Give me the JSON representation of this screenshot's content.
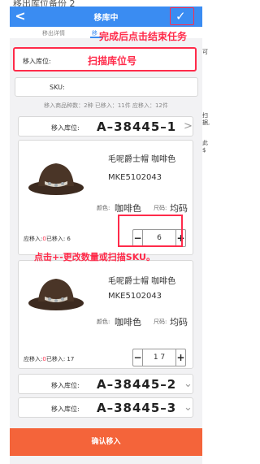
{
  "background": {
    "title": "移出库位备份 2",
    "right_top": "可",
    "right_mid": "扫据,",
    "right_low": "此$"
  },
  "navbar": {
    "back_icon": "chevron-left-icon",
    "title": "移库中",
    "confirm_icon": "check-icon",
    "color": "#3a8cf2"
  },
  "tabs": [
    {
      "label": "移出详情"
    },
    {
      "label": "移"
    }
  ],
  "callouts": {
    "finish": "完成后点击结束任务",
    "scan_location": "扫描库位号",
    "stepper_hint": "点击+-更改数量或扫描SKU。"
  },
  "location_field": {
    "label": "移入库位:"
  },
  "sku_field": {
    "label": "SKU:"
  },
  "stats": "移入商品种数：2种    已移入：11件    应移入：12件",
  "groups": [
    {
      "label": "移入库位:",
      "code": "A–38445–1",
      "items": [
        {
          "name": "毛呢爵士帽 咖啡色",
          "sku": "MKE5102043",
          "color_label": "颜色:",
          "color": "咖啡色",
          "size_label": "尺码:",
          "size": "均码",
          "due_label": "应移入:",
          "due_value": "0",
          "moved_label": "已移入:",
          "moved_value": "6",
          "qty": "6"
        },
        {
          "name": "毛呢爵士帽 咖啡色",
          "sku": "MKE5102043",
          "color_label": "颜色:",
          "color": "咖啡色",
          "size_label": "尺码:",
          "size": "均码",
          "due_label": "应移入:",
          "due_value": "0",
          "moved_label": "已移入:",
          "moved_value": "17",
          "qty": "1 7"
        }
      ]
    },
    {
      "label": "移入库位:",
      "code": "A–38445–2"
    },
    {
      "label": "移入库位:",
      "code": "A–38445–3"
    }
  ],
  "confirm_button": "确认移入",
  "accent_red": "#ff2b4a",
  "button_color": "#f4643a"
}
